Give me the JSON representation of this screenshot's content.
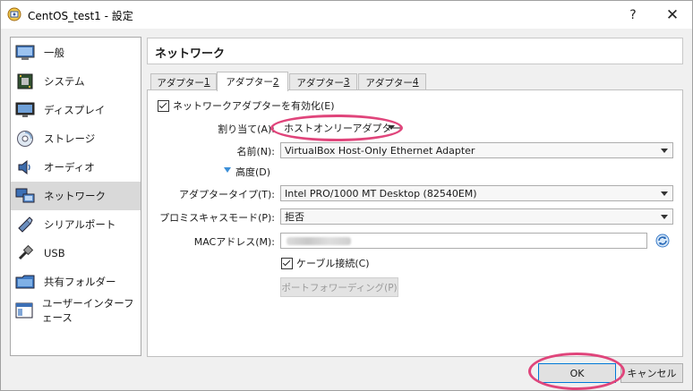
{
  "window": {
    "title": "CentOS_test1 - 設定",
    "help": "?",
    "close": "✕"
  },
  "sidebar": {
    "items": [
      {
        "label": "一般",
        "icon": "monitor-icon"
      },
      {
        "label": "システム",
        "icon": "motherboard-icon"
      },
      {
        "label": "ディスプレイ",
        "icon": "display-icon"
      },
      {
        "label": "ストレージ",
        "icon": "disc-icon"
      },
      {
        "label": "オーディオ",
        "icon": "speaker-icon"
      },
      {
        "label": "ネットワーク",
        "icon": "network-icon"
      },
      {
        "label": "シリアルポート",
        "icon": "serial-port-icon"
      },
      {
        "label": "USB",
        "icon": "usb-icon"
      },
      {
        "label": "共有フォルダー",
        "icon": "folder-icon"
      },
      {
        "label": "ユーザーインターフェース",
        "icon": "ui-window-icon"
      }
    ],
    "selected_index": 5
  },
  "header": {
    "title": "ネットワーク"
  },
  "tabs": [
    {
      "prefix": "アダプター ",
      "key": "1"
    },
    {
      "prefix": "アダプター ",
      "key": "2"
    },
    {
      "prefix": "アダプター ",
      "key": "3"
    },
    {
      "prefix": "アダプター ",
      "key": "4"
    }
  ],
  "active_tab": 1,
  "form": {
    "enable_adapter": {
      "label": "ネットワークアダプターを有効化(E)",
      "checked": true
    },
    "attached_to": {
      "label": "割り当て(A):",
      "value": "ホストオンリーアダプター"
    },
    "name": {
      "label": "名前(N):",
      "value": "VirtualBox Host-Only Ethernet Adapter"
    },
    "advanced": {
      "label": "高度(D)"
    },
    "adapter_type": {
      "label": "アダプタータイプ(T):",
      "value": "Intel PRO/1000 MT Desktop (82540EM)"
    },
    "promiscuous": {
      "label": "プロミスキャスモード(P):",
      "value": "拒否"
    },
    "mac": {
      "label": "MACアドレス(M):",
      "value": ""
    },
    "cable": {
      "label": "ケーブル接続(C)",
      "checked": true
    },
    "port_forwarding": {
      "label": "ポートフォワーディング(P)"
    }
  },
  "buttons": {
    "ok": "OK",
    "cancel": "キャンセル"
  },
  "colors": {
    "highlight": "#e0457b",
    "selection": "#d9d9d9",
    "accent": "#0078d7"
  }
}
